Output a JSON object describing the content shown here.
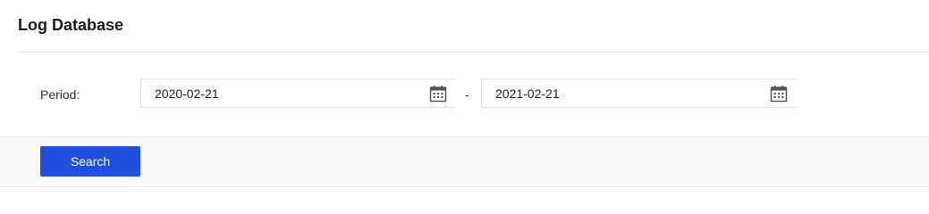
{
  "header": {
    "title": "Log Database"
  },
  "filters": {
    "period_label": "Period:",
    "start_date": "2020-02-21",
    "separator": "-",
    "end_date": "2021-02-21"
  },
  "actions": {
    "search_label": "Search"
  },
  "icons": {
    "date_picker": "calendar-icon"
  },
  "colors": {
    "primary": "#1f4fdc",
    "border": "#e2e2e2",
    "footer_background": "#fafafa"
  }
}
